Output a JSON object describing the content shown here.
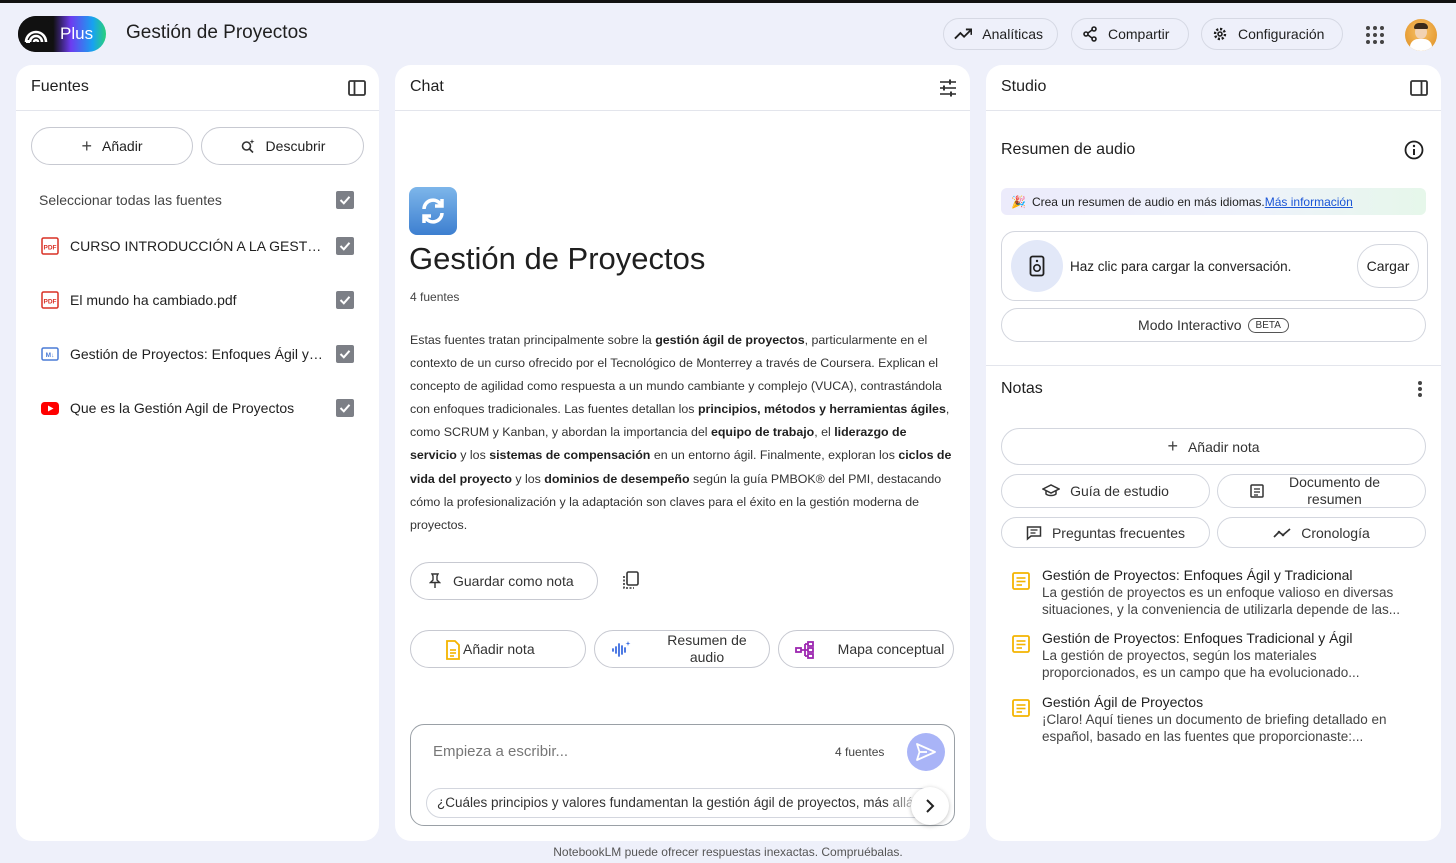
{
  "header": {
    "logo_badge": "Plus",
    "title": "Gestión de Proyectos",
    "analytics_label": "Analíticas",
    "share_label": "Compartir",
    "settings_label": "Configuración"
  },
  "sources": {
    "title": "Fuentes",
    "add_label": "Añadir",
    "discover_label": "Descubrir",
    "select_all_label": "Seleccionar todas las fuentes",
    "items": [
      {
        "label": "CURSO INTRODUCCIÓN A LA GESTIÓN ...",
        "icon": "pdf-icon",
        "checked": true
      },
      {
        "label": "El mundo ha cambiado.pdf",
        "icon": "pdf-icon",
        "checked": true
      },
      {
        "label": "Gestión de Proyectos: Enfoques Ágil y T...",
        "icon": "markdown-icon",
        "checked": true
      },
      {
        "label": "Que es la Gestión Agil de Proyectos",
        "icon": "youtube-icon",
        "checked": true
      }
    ]
  },
  "chat": {
    "title": "Chat",
    "notebook_title": "Gestión de Proyectos",
    "source_count": "4 fuentes",
    "summary": {
      "p1": "Estas fuentes tratan principalmente sobre la ",
      "b1": "gestión ágil de proyectos",
      "p2": ", particularmente en el contexto de un curso ofrecido por el Tecnológico de Monterrey a través de Coursera. Explican el concepto de agilidad como respuesta a un mundo cambiante y complejo (VUCA), contrastándola con enfoques tradicionales. Las fuentes detallan los ",
      "b2": "principios, métodos y herramientas ágiles",
      "p3": ", como SCRUM y Kanban, y abordan la importancia del ",
      "b3": "equipo de trabajo",
      "p4": ", el ",
      "b4": "liderazgo de servicio",
      "p5": " y los ",
      "b5": "sistemas de compensación",
      "p6": " en un entorno ágil. Finalmente, exploran los ",
      "b6": "ciclos de vida del proyecto",
      "p7": " y los ",
      "b7": "dominios de desempeño",
      "p8": " según la guía PMBOK® del PMI, destacando cómo la profesionalización y la adaptación son claves para el éxito en la gestión moderna de proyectos."
    },
    "save_note_label": "Guardar como nota",
    "actions": [
      {
        "label": "Añadir nota"
      },
      {
        "label": "Resumen de audio"
      },
      {
        "label": "Mapa conceptual"
      }
    ],
    "input_placeholder": "Empieza a escribir...",
    "input_source_count": "4 fuentes",
    "suggestion": "¿Cuáles principios y valores fundamentan la gestión ágil de proyectos, más allá"
  },
  "studio": {
    "title": "Studio",
    "audio_title": "Resumen de audio",
    "banner_text": "Crea un resumen de audio en más idiomas.",
    "banner_link": "Más información",
    "load_text": "Haz clic para cargar la conversación.",
    "load_button": "Cargar",
    "interactive_label": "Modo Interactivo",
    "beta_label": "BETA",
    "notes_title": "Notas",
    "add_note_label": "Añadir nota",
    "study_guide_label": "Guía de estudio",
    "summary_doc_label": "Documento de resumen",
    "faq_label": "Preguntas frecuentes",
    "timeline_label": "Cronología",
    "notes": [
      {
        "title": "Gestión de Proyectos: Enfoques Ágil y Tradicional",
        "body": "La gestión de proyectos es un enfoque valioso en diversas situaciones, y la conveniencia de utilizarla depende de las..."
      },
      {
        "title": "Gestión de Proyectos: Enfoques Tradicional y Ágil",
        "body": "La gestión de proyectos, según los materiales proporcionados, es un campo que ha evolucionado..."
      },
      {
        "title": "Gestión Ágil de Proyectos",
        "body": "¡Claro! Aquí tienes un documento de briefing detallado en español, basado en las fuentes que proporcionaste:..."
      }
    ]
  },
  "footer": {
    "disclaimer": "NotebookLM puede ofrecer respuestas inexactas. Compruébalas."
  },
  "colors": {
    "background": "#eef0fa",
    "panel": "#ffffff",
    "send_button": "#a9b4f7",
    "pdf_red": "#d93025",
    "youtube_red": "#ff0000",
    "markdown_blue": "#4a7bd6",
    "note_yellow": "#f4b400",
    "link_blue": "#1a55d6"
  }
}
